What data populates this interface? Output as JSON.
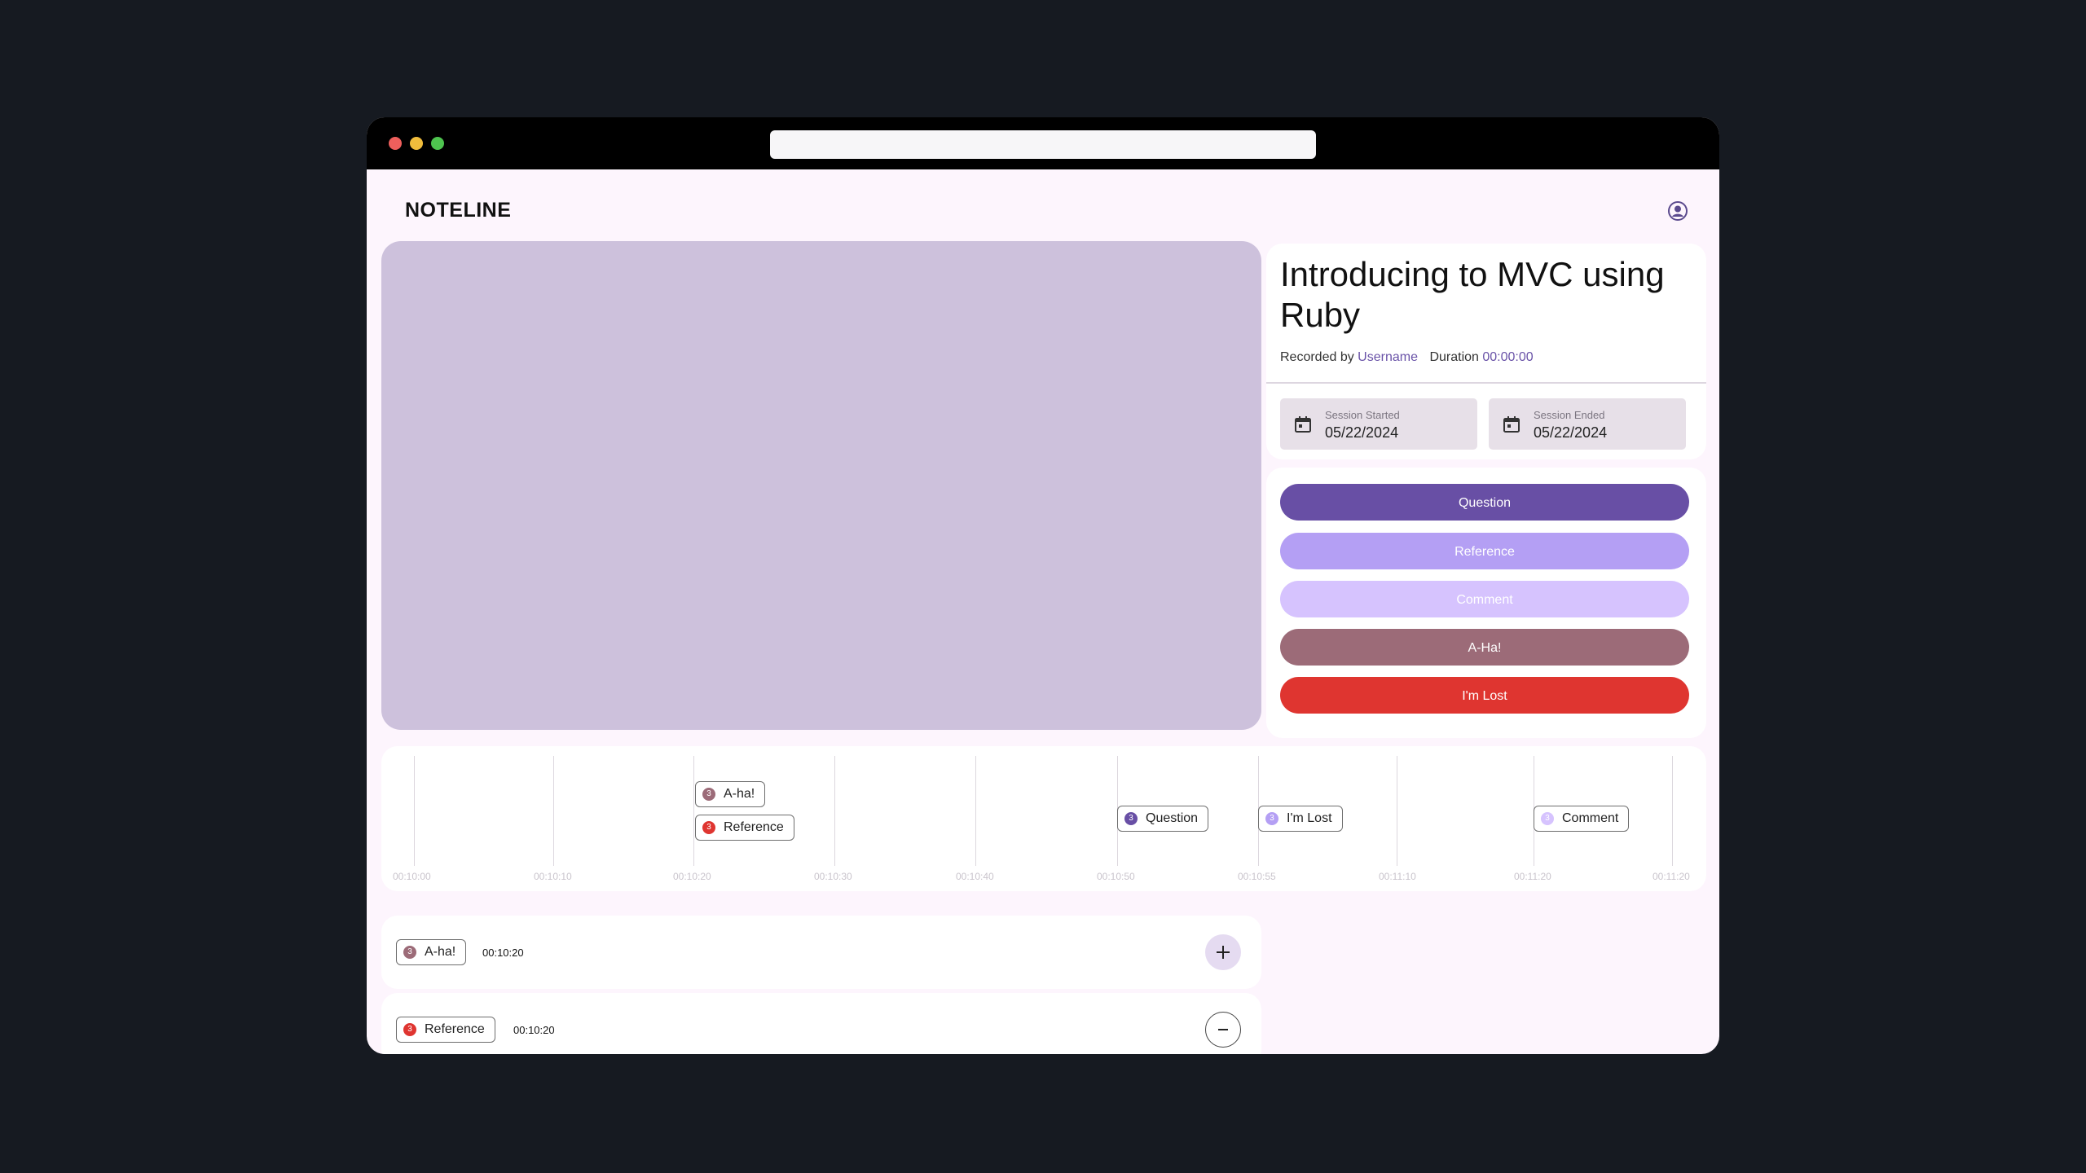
{
  "app": {
    "logo": "NOTELINE",
    "icons": {
      "user": "user-circle-icon",
      "calendar": "calendar-icon",
      "add": "plus-icon",
      "remove": "minus-icon"
    }
  },
  "colors": {
    "page_bg": "#161a21",
    "app_bg": "#fdf5fd",
    "video_placeholder": "#cdc1dc",
    "question": "#684fa5",
    "reference": "#b49ff4",
    "comment": "#d6c3fe",
    "aha": "#9c6b78",
    "lost": "#df3530"
  },
  "session": {
    "title": "Introducing to MVC using Ruby",
    "recorded_by_label": "Recorded by",
    "username": "Username",
    "duration_label": "Duration",
    "duration": "00:00:00",
    "started_label": "Session Started",
    "started": "05/22/2024",
    "ended_label": "Session Ended",
    "ended": "05/22/2024"
  },
  "actions": [
    {
      "label": "Question",
      "color": "#684fa5"
    },
    {
      "label": "Reference",
      "color": "#b49ff4"
    },
    {
      "label": "Comment",
      "color": "#d6c3fe"
    },
    {
      "label": "A-Ha!",
      "color": "#9c6b78"
    },
    {
      "label": "I'm Lost",
      "color": "#df3530"
    }
  ],
  "timeline": {
    "ticks": [
      "00:10:00",
      "00:10:10",
      "00:10:20",
      "00:10:30",
      "00:10:40",
      "00:10:50",
      "00:10:55",
      "00:11:10",
      "00:11:20",
      "00:11:20"
    ],
    "markers": [
      {
        "label": "A-ha!",
        "count": "3",
        "color": "#9c6b78"
      },
      {
        "label": "Reference",
        "count": "3",
        "color": "#df3530"
      },
      {
        "label": "Question",
        "count": "3",
        "color": "#684fa5"
      },
      {
        "label": "I'm Lost",
        "count": "3",
        "color": "#b49ff4"
      },
      {
        "label": "Comment",
        "count": "3",
        "color": "#d6c3fe"
      }
    ]
  },
  "notes": [
    {
      "label": "A-ha!",
      "count": "3",
      "time": "00:10:20",
      "color": "#9c6b78"
    },
    {
      "label": "Reference",
      "count": "3",
      "time": "00:10:20",
      "color": "#df3530"
    }
  ]
}
